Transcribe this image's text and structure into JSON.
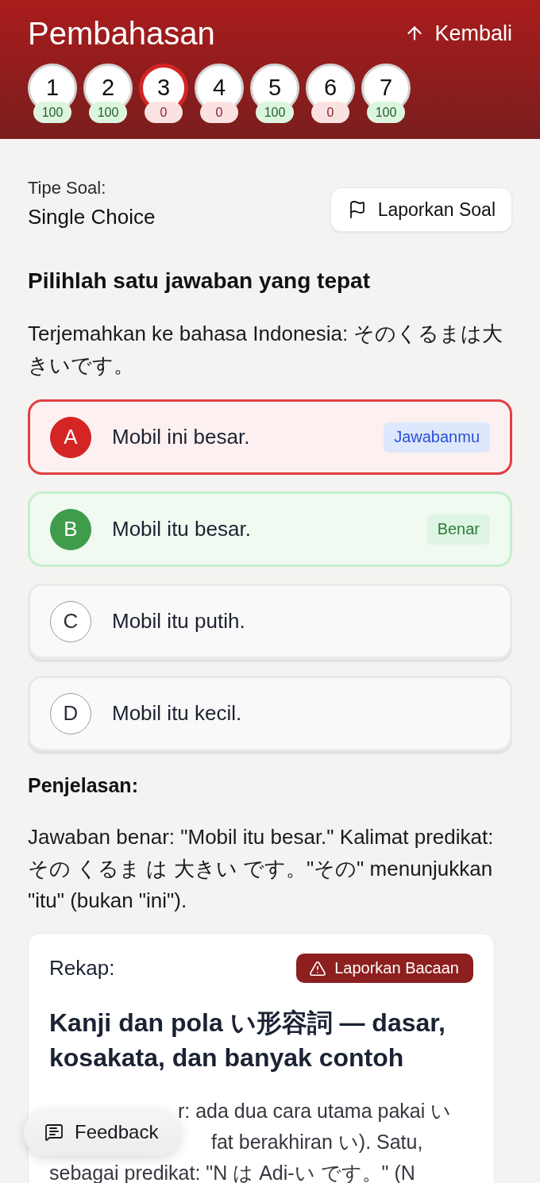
{
  "header": {
    "title": "Pembahasan",
    "back_label": "Kembali"
  },
  "questions": [
    {
      "number": "1",
      "score": "100",
      "selected": false,
      "correct": true
    },
    {
      "number": "2",
      "score": "100",
      "selected": false,
      "correct": true
    },
    {
      "number": "3",
      "score": "0",
      "selected": true,
      "correct": false
    },
    {
      "number": "4",
      "score": "0",
      "selected": false,
      "correct": false
    },
    {
      "number": "5",
      "score": "100",
      "selected": false,
      "correct": true
    },
    {
      "number": "6",
      "score": "0",
      "selected": false,
      "correct": false
    },
    {
      "number": "7",
      "score": "100",
      "selected": false,
      "correct": true
    }
  ],
  "question": {
    "type_label": "Tipe Soal:",
    "type_value": "Single Choice",
    "report_label": "Laporkan Soal",
    "instruction": "Pilihlah satu jawaban yang tepat",
    "prompt": "Terjemahkan ke bahasa Indonesia: そのくるまは大きいです。"
  },
  "options": [
    {
      "letter": "A",
      "text": "Mobil ini besar.",
      "selected": true,
      "correct": false,
      "badge": {
        "kind": "yours",
        "label": "Jawabanmu"
      }
    },
    {
      "letter": "B",
      "text": "Mobil itu besar.",
      "selected": false,
      "correct": true,
      "badge": {
        "kind": "correct",
        "label": "Benar"
      }
    },
    {
      "letter": "C",
      "text": "Mobil itu putih.",
      "selected": false,
      "correct": false
    },
    {
      "letter": "D",
      "text": "Mobil itu kecil.",
      "selected": false,
      "correct": false
    }
  ],
  "explanation": {
    "heading": "Penjelasan:",
    "text": "Jawaban benar: \"Mobil itu besar.\" Kalimat predikat: その くるま は 大きい です。\"その\" menunjukkan \"itu\" (bukan \"ini\")."
  },
  "recap": {
    "label": "Rekap:",
    "report_label": "Laporkan Bacaan",
    "title": "Kanji dan pola い形容詞 — dasar, kosakata, dan banyak contoh",
    "body_lines": [
      "r: ada dua cara utama pakai い",
      "fat berakhiran い). Satu,",
      "sebagai predikat: \"N は Adi-い です。\" (N"
    ]
  },
  "feedback_button": {
    "label": "Feedback"
  }
}
